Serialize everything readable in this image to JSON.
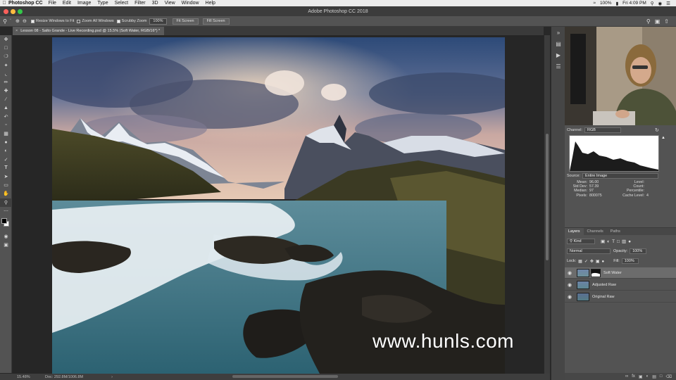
{
  "menubar": {
    "app": "Photoshop CC",
    "items": [
      "File",
      "Edit",
      "Image",
      "Type",
      "Select",
      "Filter",
      "3D",
      "View",
      "Window",
      "Help"
    ],
    "battery": "100%",
    "clock": "Fri 4:09 PM"
  },
  "window": {
    "title": "Adobe Photoshop CC 2018"
  },
  "options": {
    "resize_windows": "Resize Windows to Fit",
    "zoom_all": "Zoom All Windows",
    "scrubby_zoom": "Scrubby Zoom",
    "zoom_value": "100%",
    "fit_screen": "Fit Screen",
    "fill_screen": "Fill Screen"
  },
  "document": {
    "tab_title": "Lesson 08 - Salto Grande - Live Recording.psd @ 15.5% (Soft Water, RGB/16*) *"
  },
  "status": {
    "zoom": "15.48%",
    "doc": "Doc: 292.8M/1006.8M"
  },
  "watermark": "www.hunls.com",
  "histogram": {
    "channel_label": "Channel:",
    "channel_value": "RGB",
    "source_label": "Source:",
    "source_value": "Entire Image",
    "stats_left": [
      {
        "k": "Mean:",
        "v": "96.00"
      },
      {
        "k": "Std Dev:",
        "v": "57.39"
      },
      {
        "k": "Median:",
        "v": "97"
      },
      {
        "k": "Pixels:",
        "v": "800075"
      }
    ],
    "stats_right": [
      {
        "k": "Level:",
        "v": ""
      },
      {
        "k": "Count:",
        "v": ""
      },
      {
        "k": "Percentile:",
        "v": ""
      },
      {
        "k": "Cache Level:",
        "v": "4"
      }
    ]
  },
  "layers_panel": {
    "tabs": [
      "Layers",
      "Channels",
      "Paths"
    ],
    "filter": "Kind",
    "blend_mode": "Normal",
    "opacity_label": "Opacity:",
    "opacity_value": "100%",
    "lock_label": "Lock:",
    "fill_label": "Fill:",
    "fill_value": "100%",
    "layers": [
      {
        "name": "Soft Water",
        "selected": true
      },
      {
        "name": "Adjusted Raw",
        "selected": false
      },
      {
        "name": "Original Raw",
        "selected": false
      }
    ]
  },
  "colors": {
    "accent": "#535353",
    "canvas_bg": "#262626",
    "selected_layer": "#6c6c6c"
  }
}
